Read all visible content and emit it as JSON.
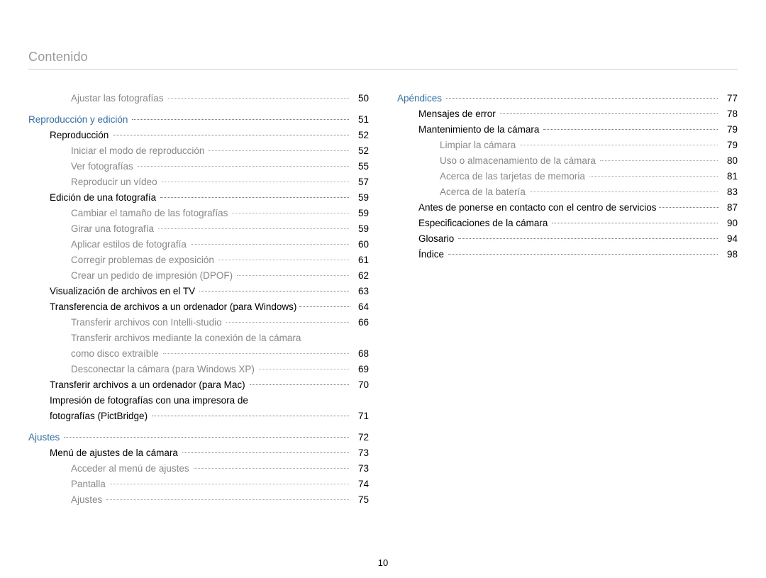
{
  "header": "Contenido",
  "page_number": "10",
  "columns": [
    [
      {
        "class": "l3",
        "label": "Ajustar las fotografías",
        "page": "50"
      },
      {
        "spacer": 8
      },
      {
        "class": "section",
        "label": "Reproducción y edición",
        "page": "51"
      },
      {
        "class": "l1",
        "label": "Reproducción",
        "page": "52"
      },
      {
        "class": "l3",
        "label": "Iniciar el modo de reproducción",
        "page": "52"
      },
      {
        "class": "l3",
        "label": "Ver fotografías",
        "page": "55"
      },
      {
        "class": "l3",
        "label": "Reproducir un vídeo",
        "page": "57"
      },
      {
        "class": "l1",
        "label": "Edición de una fotografía",
        "page": "59"
      },
      {
        "class": "l3",
        "label": "Cambiar el tamaño de las fotografías",
        "page": "59"
      },
      {
        "class": "l3",
        "label": "Girar una fotografía",
        "page": "59"
      },
      {
        "class": "l3",
        "label": "Aplicar estilos de fotografía",
        "page": "60"
      },
      {
        "class": "l3",
        "label": "Corregir problemas de exposición",
        "page": "61"
      },
      {
        "class": "l3",
        "label": "Crear un pedido de impresión (DPOF)",
        "page": "62"
      },
      {
        "class": "l1",
        "label": "Visualización de archivos en el TV",
        "page": "63"
      },
      {
        "class": "l1",
        "label": "Transferencia de archivos a un ordenador (para Windows)",
        "page": "64",
        "tight": true
      },
      {
        "class": "l3",
        "label": "Transferir archivos con Intelli-studio",
        "page": "66"
      },
      {
        "class": "l3",
        "label": "Transferir archivos mediante la conexión de la cámara",
        "nopage": true
      },
      {
        "class": "l3",
        "label": "como disco extraíble",
        "page": "68"
      },
      {
        "class": "l3",
        "label": "Desconectar la cámara (para Windows XP)",
        "page": "69"
      },
      {
        "class": "l1",
        "label": "Transferir archivos a un ordenador (para Mac)",
        "page": "70"
      },
      {
        "class": "l1",
        "label": "Impresión de fotografías con una impresora de",
        "nopage": true
      },
      {
        "class": "l1",
        "label": "fotografías (PictBridge)",
        "page": "71"
      },
      {
        "spacer": 8
      },
      {
        "class": "section",
        "label": "Ajustes",
        "page": "72"
      },
      {
        "class": "l1",
        "label": "Menú de ajustes de la cámara",
        "page": "73"
      },
      {
        "class": "l3",
        "label": "Acceder al menú de ajustes",
        "page": "73"
      },
      {
        "class": "l3",
        "label": "Pantalla",
        "page": "74"
      },
      {
        "class": "l3",
        "label": "Ajustes",
        "page": "75"
      }
    ],
    [
      {
        "class": "section",
        "label": "Apéndices",
        "page": "77"
      },
      {
        "class": "l1",
        "label": "Mensajes de error",
        "page": "78"
      },
      {
        "class": "l1",
        "label": "Mantenimiento de la cámara",
        "page": "79"
      },
      {
        "class": "l3",
        "label": "Limpiar la cámara",
        "page": "79"
      },
      {
        "class": "l3",
        "label": "Uso o almacenamiento de la cámara",
        "page": "80"
      },
      {
        "class": "l3",
        "label": "Acerca de las tarjetas de memoria",
        "page": "81"
      },
      {
        "class": "l3",
        "label": "Acerca de la batería",
        "page": "83"
      },
      {
        "class": "l1",
        "label": "Antes de ponerse en contacto con el centro de servicios",
        "page": "87",
        "tight": true
      },
      {
        "class": "l1",
        "label": "Especificaciones de la cámara",
        "page": "90"
      },
      {
        "class": "l1",
        "label": "Glosario",
        "page": "94"
      },
      {
        "class": "l1",
        "label": "Índice",
        "page": "98"
      }
    ]
  ]
}
